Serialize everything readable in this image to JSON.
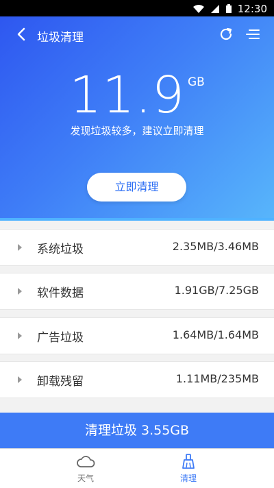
{
  "status": {
    "time": "12:30",
    "icons": [
      "wifi-icon",
      "signal-icon",
      "battery-icon"
    ]
  },
  "header": {
    "title": "垃圾清理",
    "back_icon": "back-arrow-icon",
    "refresh_icon": "refresh-icon",
    "menu_icon": "menu-icon"
  },
  "summary": {
    "size": "11.9",
    "unit": "GB",
    "hint": "发现垃圾较多，建议立即清理"
  },
  "cta_label": "立即清理",
  "categories": [
    {
      "name": "系统垃圾",
      "value": "2.35MB/3.46MB"
    },
    {
      "name": "软件数据",
      "value": "1.91GB/7.25GB"
    },
    {
      "name": "广告垃圾",
      "value": "1.64MB/1.64MB"
    },
    {
      "name": "卸载残留",
      "value": "1.11MB/235MB"
    }
  ],
  "clean_button": "清理垃圾 3.55GB",
  "tabs": [
    {
      "label": "天气",
      "icon": "cloud-icon"
    },
    {
      "label": "清理",
      "icon": "broom-icon"
    }
  ],
  "colors": {
    "accent": "#3e7bf6",
    "gradient_start": "#2e57f0",
    "gradient_end": "#58b6fb"
  }
}
